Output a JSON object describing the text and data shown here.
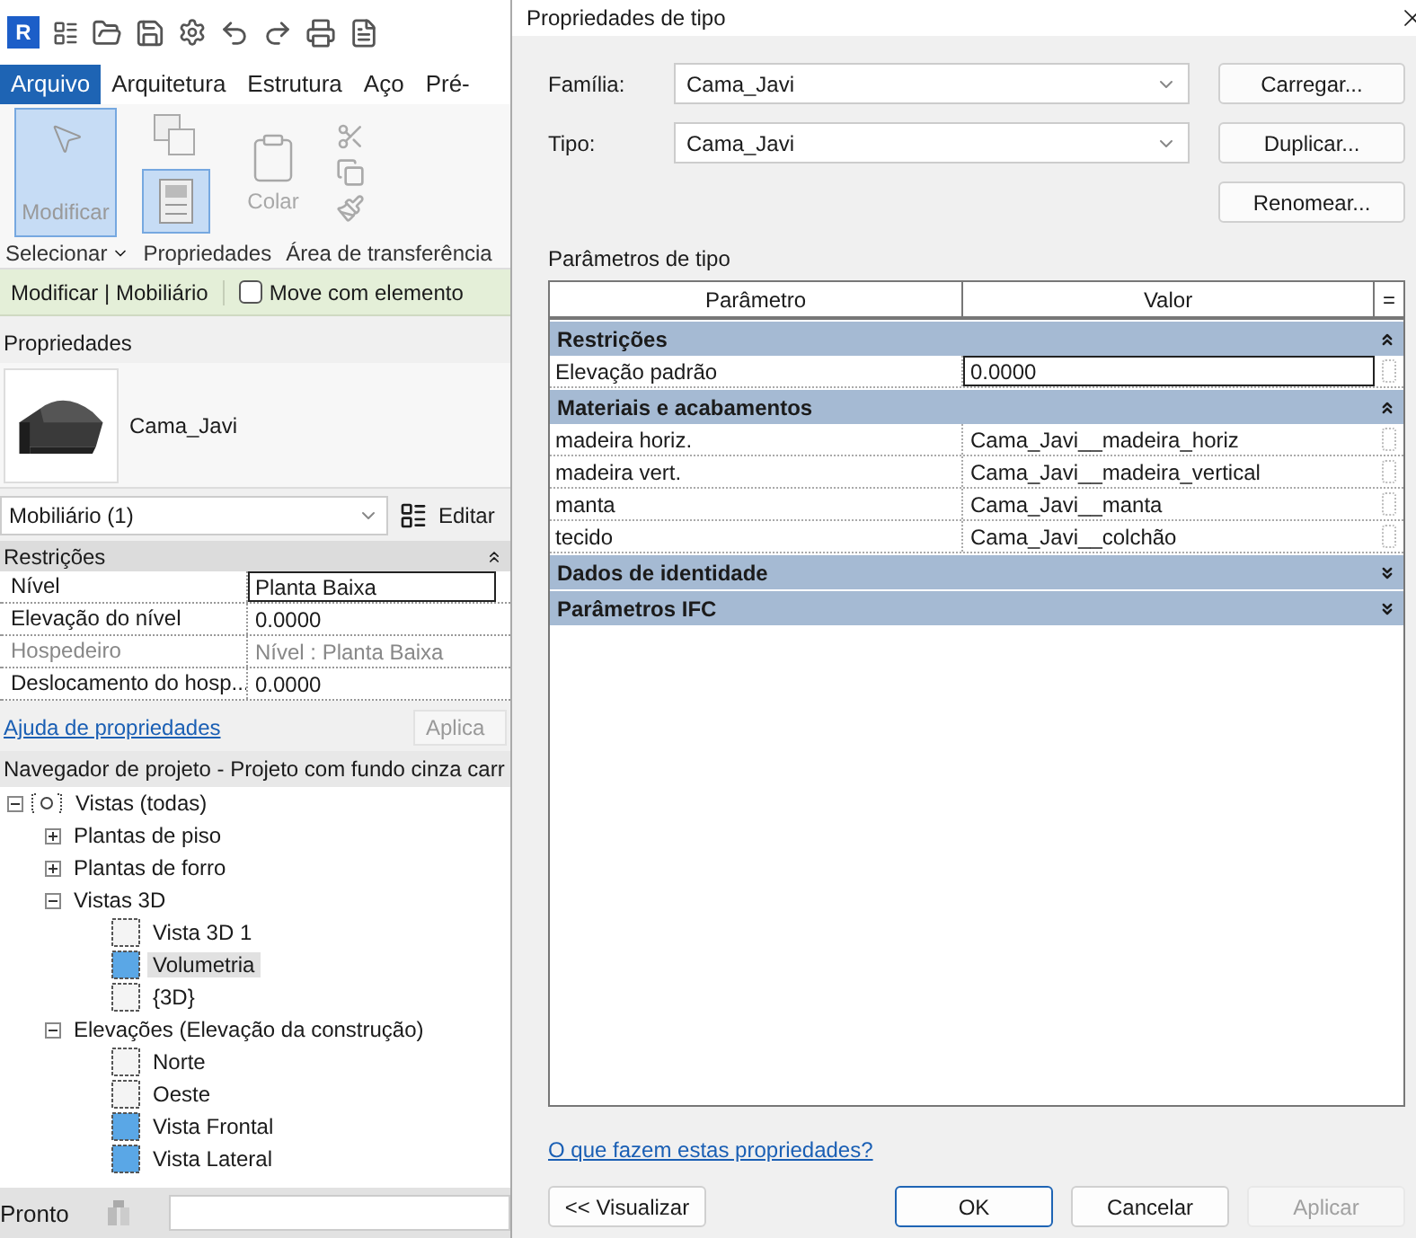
{
  "app": {
    "logo": "R",
    "ribbon": {
      "tabs": [
        {
          "label": "Arquivo",
          "selected": true
        },
        {
          "label": "Arquitetura",
          "selected": false
        },
        {
          "label": "Estrutura",
          "selected": false
        },
        {
          "label": "Aço",
          "selected": false
        },
        {
          "label": "Pré-",
          "selected": false
        }
      ],
      "modify_button": {
        "label": "Modificar",
        "active": true
      },
      "properties_toggle": {
        "active": true
      },
      "paste_button": {
        "label": "Colar",
        "disabled": true
      },
      "panel_labels": [
        "Selecionar",
        "Propriedades",
        "Área de transferência"
      ]
    },
    "context_bar": {
      "title": "Modificar | Mobiliário",
      "move_with": {
        "label": "Move com elemento",
        "checked": false
      }
    },
    "properties": {
      "title": "Propriedades",
      "type_name": "Cama_Javi",
      "selector": "Mobiliário (1)",
      "edit_type": "Editar",
      "groups": [
        {
          "name": "Restrições",
          "expanded": true,
          "rows": [
            {
              "name": "Nível",
              "value": "Planta Baixa",
              "editing": true,
              "disabled": false
            },
            {
              "name": "Elevação do nível",
              "value": "0.0000",
              "editing": false,
              "disabled": false
            },
            {
              "name": "Hospedeiro",
              "value": "Nível : Planta Baixa",
              "editing": false,
              "disabled": true
            },
            {
              "name": "Deslocamento do hosp...",
              "value": "0.0000",
              "editing": false,
              "disabled": false
            }
          ]
        }
      ],
      "help_link": "Ajuda de propriedades",
      "apply_button": {
        "label": "Aplica",
        "disabled": true
      }
    },
    "navigator": {
      "title": "Navegador de projeto - Projeto com fundo cinza carr",
      "tree": [
        {
          "label": "Vistas (todas)",
          "kind": "root",
          "expanded": true,
          "children": [
            {
              "label": "Plantas de piso",
              "kind": "group",
              "expanded": false
            },
            {
              "label": "Plantas de forro",
              "kind": "group",
              "expanded": false
            },
            {
              "label": "Vistas 3D",
              "kind": "group",
              "expanded": true,
              "children": [
                {
                  "label": "Vista 3D 1",
                  "kind": "view",
                  "on_sheet": false,
                  "selected": false
                },
                {
                  "label": "Volumetria",
                  "kind": "view",
                  "on_sheet": true,
                  "selected": true
                },
                {
                  "label": "{3D}",
                  "kind": "view",
                  "on_sheet": false,
                  "selected": false
                }
              ]
            },
            {
              "label": "Elevações (Elevação da construção)",
              "kind": "group",
              "expanded": true,
              "children": [
                {
                  "label": "Norte",
                  "kind": "view",
                  "on_sheet": false,
                  "selected": false
                },
                {
                  "label": "Oeste",
                  "kind": "view",
                  "on_sheet": false,
                  "selected": false
                },
                {
                  "label": "Vista Frontal",
                  "kind": "view",
                  "on_sheet": true,
                  "selected": false
                },
                {
                  "label": "Vista Lateral",
                  "kind": "view",
                  "on_sheet": true,
                  "selected": false
                }
              ]
            }
          ]
        }
      ]
    },
    "status_bar": {
      "text": "Pronto"
    }
  },
  "dialog": {
    "title": "Propriedades de tipo",
    "fields": [
      {
        "label": "Família:",
        "value": "Cama_Javi"
      },
      {
        "label": "Tipo:",
        "value": "Cama_Javi"
      }
    ],
    "side_buttons": [
      "Carregar...",
      "Duplicar...",
      "Renomear..."
    ],
    "section_label": "Parâmetros de tipo",
    "columns": [
      "Parâmetro",
      "Valor"
    ],
    "sort_glyph": "=",
    "groups": [
      {
        "name": "Restrições",
        "expanded": true,
        "rows": [
          {
            "name": "Elevação padrão",
            "value": "0.0000",
            "editing": true
          }
        ]
      },
      {
        "name": "Materiais e acabamentos",
        "expanded": true,
        "rows": [
          {
            "name": "madeira horiz.",
            "value": "Cama_Javi__madeira_horiz",
            "editing": false
          },
          {
            "name": "madeira vert.",
            "value": "Cama_Javi__madeira_vertical",
            "editing": false
          },
          {
            "name": "manta",
            "value": "Cama_Javi__manta",
            "editing": false
          },
          {
            "name": "tecido",
            "value": "Cama_Javi__colchão",
            "editing": false
          }
        ]
      },
      {
        "name": "Dados de identidade",
        "expanded": false
      },
      {
        "name": "Parâmetros IFC",
        "expanded": false
      }
    ],
    "help_link": "O que fazem estas propriedades?",
    "buttons": [
      {
        "label": "<< Visualizar",
        "kind": "normal"
      },
      {
        "label": "OK",
        "kind": "default"
      },
      {
        "label": "Cancelar",
        "kind": "normal"
      },
      {
        "label": "Aplicar",
        "kind": "disabled"
      }
    ]
  }
}
